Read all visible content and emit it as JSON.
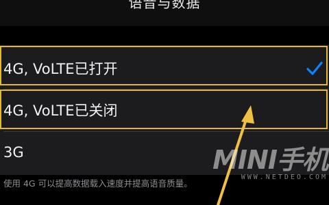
{
  "nav": {
    "title": "语音与数据"
  },
  "options": [
    {
      "label": "4G, VoLTE已打开",
      "selected": true
    },
    {
      "label": "4G, VoLTE已关闭",
      "selected": false
    },
    {
      "label": "3G",
      "selected": false
    }
  ],
  "footer": {
    "text": "使用 4G 可以提高数据载入速度并提高语音质量。"
  },
  "watermark": {
    "main": "MINI手机",
    "sub": "WWW.NETDEO.COM"
  },
  "colors": {
    "highlight": "#e5b833",
    "check": "#0a84ff",
    "arrow": "#f0c040"
  }
}
